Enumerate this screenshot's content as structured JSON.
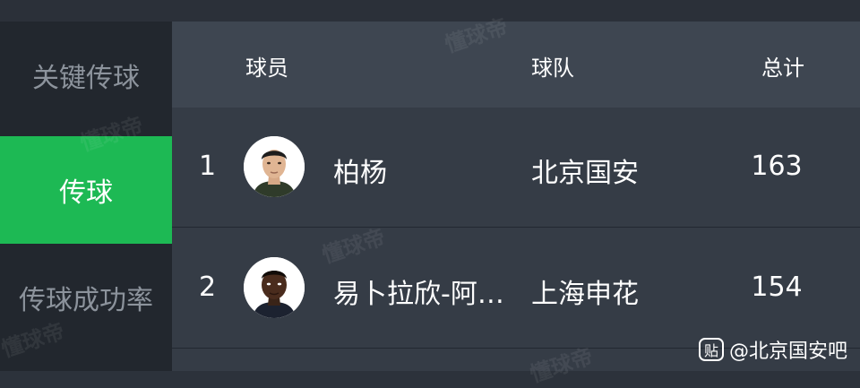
{
  "sidebar": {
    "items": [
      {
        "label": "关键传球",
        "active": false
      },
      {
        "label": "传球",
        "active": true
      },
      {
        "label": "传球成功率",
        "active": false
      }
    ]
  },
  "table": {
    "headers": {
      "player": "球员",
      "team": "球队",
      "total": "总计"
    },
    "rows": [
      {
        "rank": "1",
        "player": "柏杨",
        "team": "北京国安",
        "total": "163"
      },
      {
        "rank": "2",
        "player": "易卜拉欣-阿…",
        "team": "上海申花",
        "total": "154"
      }
    ]
  },
  "watermark": "懂球帝",
  "source": {
    "icon": "贴",
    "label": "@北京国安吧"
  },
  "colors": {
    "accent": "#1db954",
    "sidebar_bg": "#22272e",
    "header_bg": "#3e4651",
    "row_bg": "#353c46"
  }
}
